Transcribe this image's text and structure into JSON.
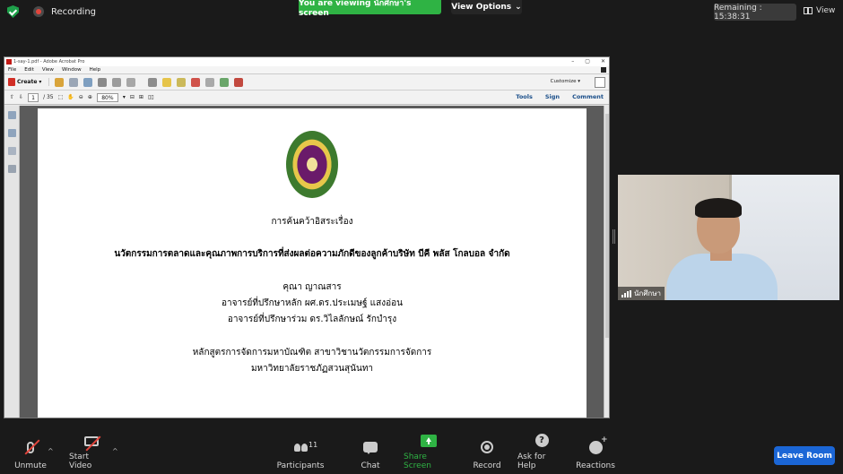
{
  "top": {
    "recording": "Recording",
    "viewing": "You are viewing นักศึกษา's screen",
    "view_options": "View Options",
    "remaining": "Remaining : 15:38:31",
    "view": "View"
  },
  "acrobat": {
    "title": "1-say-1.pdf - Adobe Acrobat Pro",
    "menu": [
      "File",
      "Edit",
      "View",
      "Window",
      "Help"
    ],
    "create": "Create",
    "customize": "Customize",
    "page_current": "1",
    "page_total": "/ 35",
    "zoom": "80%",
    "tools": "Tools",
    "sign": "Sign",
    "comment": "Comment"
  },
  "document": {
    "type_line": "การค้นคว้าอิสระเรื่อง",
    "title": "นวัตกรรมการตลาดและคุณภาพการบริการที่ส่งผลต่อความภักดีของลูกค้าบริษัท บีคี พลัส โกลบอล จำกัด",
    "author": "คุณา ญาณสาร",
    "advisor_main": "อาจารย์ที่ปรึกษาหลัก ผศ.ดร.ประเมษฐ์ แสงอ่อน",
    "advisor_co": "อาจารย์ที่ปรึกษาร่วม ดร.วิไลลักษณ์ รักบำรุง",
    "program": "หลักสูตรการจัดการมหาบัณฑิต สาขาวิชานวัตกรรมการจัดการ",
    "university": "มหาวิทยาลัยราชภัฏสวนสุนันทา"
  },
  "video": {
    "participant_name": "นักศึกษา"
  },
  "toolbar": {
    "unmute": "Unmute",
    "start_video": "Start Video",
    "participants": "Participants",
    "participants_count": "11",
    "chat": "Chat",
    "share_screen": "Share Screen",
    "record": "Record",
    "ask_for_help": "Ask for Help",
    "reactions": "Reactions",
    "leave_room": "Leave Room"
  },
  "colors": {
    "share_green": "#2fb344",
    "leave_blue": "#1b66d6",
    "record_red": "#e2453c"
  }
}
